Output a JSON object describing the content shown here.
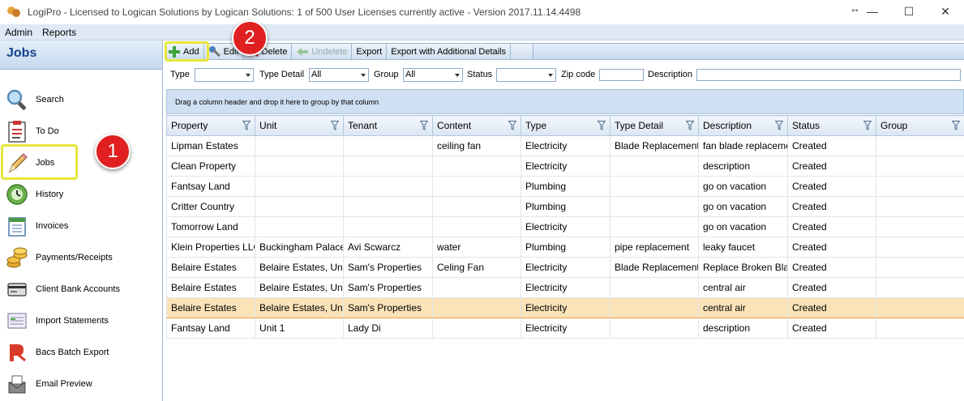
{
  "window": {
    "title": "LogiPro - Licensed to Logican Solutions by Logican Solutions: 1 of 500 User Licenses currently active - Version 2017.11.14.4498",
    "controls": {
      "minimize": "—",
      "maximize": "☐",
      "close": "✕",
      "resize": "↔"
    }
  },
  "menu": {
    "items": [
      "Admin",
      "Reports"
    ]
  },
  "sidebar": {
    "header": "Jobs",
    "items": [
      {
        "label": "Search",
        "icon": "search-icon"
      },
      {
        "label": "To Do",
        "icon": "todo-icon"
      },
      {
        "label": "Jobs",
        "icon": "pencil-icon"
      },
      {
        "label": "History",
        "icon": "history-icon"
      },
      {
        "label": "Invoices",
        "icon": "invoice-icon"
      },
      {
        "label": "Payments/Receipts",
        "icon": "coins-icon"
      },
      {
        "label": "Client Bank Accounts",
        "icon": "bank-card-icon"
      },
      {
        "label": "Import Statements",
        "icon": "import-icon"
      },
      {
        "label": "Bacs Batch Export",
        "icon": "bacs-icon"
      },
      {
        "label": "Email Preview",
        "icon": "email-icon"
      }
    ]
  },
  "badges": {
    "one": "1",
    "two": "2"
  },
  "toolbar": {
    "add": "Add",
    "edit": "Edit",
    "delete": "Delete",
    "undelete": "Undelete",
    "export": "Export",
    "export_details": "Export with Additional Details"
  },
  "filters": {
    "type_label": "Type",
    "type_value": "",
    "type_detail_label": "Type Detail",
    "type_detail_value": "All",
    "group_label": "Group",
    "group_value": "All",
    "status_label": "Status",
    "status_value": "",
    "zip_label": "Zip code",
    "zip_value": "",
    "description_label": "Description",
    "description_value": ""
  },
  "grid": {
    "group_hint": "Drag a column header and drop it here to group by that column",
    "columns": [
      "Property",
      "Unit",
      "Tenant",
      "Content",
      "Type",
      "Type Detail",
      "Description",
      "Status",
      "Group"
    ],
    "rows": [
      [
        "Lipman Estates",
        "",
        "",
        "ceiling fan",
        "Electricity",
        "Blade Replacement",
        "fan blade replacemen",
        "Created",
        ""
      ],
      [
        "Clean Property",
        "",
        "",
        "",
        "Electricity",
        "",
        "description",
        "Created",
        ""
      ],
      [
        "Fantsay Land",
        "",
        "",
        "",
        "Plumbing",
        "",
        "go on vacation",
        "Created",
        ""
      ],
      [
        "Critter Country",
        "",
        "",
        "",
        "Plumbing",
        "",
        "go on vacation",
        "Created",
        ""
      ],
      [
        "Tomorrow Land",
        "",
        "",
        "",
        "Electricity",
        "",
        "go on vacation",
        "Created",
        ""
      ],
      [
        "Klein Properties LLC",
        "Buckingham Palace",
        "Avi Scwarcz",
        "water",
        "Plumbing",
        "pipe replacement",
        "leaky faucet",
        "Created",
        ""
      ],
      [
        "Belaire Estates",
        "Belaire Estates, Unit",
        "Sam's Properties",
        "Celing Fan",
        "Electricity",
        "Blade Replacement",
        "Replace Broken Blad",
        "Created",
        ""
      ],
      [
        "Belaire Estates",
        "Belaire Estates, Unit",
        "Sam's Properties",
        "",
        "Electricity",
        "",
        "central air",
        "Created",
        ""
      ],
      [
        "Belaire Estates",
        "Belaire Estates, Unit",
        "Sam's Properties",
        "",
        "Electricity",
        "",
        "central air",
        "Created",
        ""
      ],
      [
        "Fantsay Land",
        "Unit 1",
        "Lady Di",
        "",
        "Electricity",
        "",
        "description",
        "Created",
        ""
      ]
    ],
    "selected_row": 8
  },
  "colors": {
    "accent_blue": "#15428b",
    "highlight_yellow": "#e6e63a",
    "badge_red": "#e02020",
    "selected_row": "#fbe3b8"
  }
}
